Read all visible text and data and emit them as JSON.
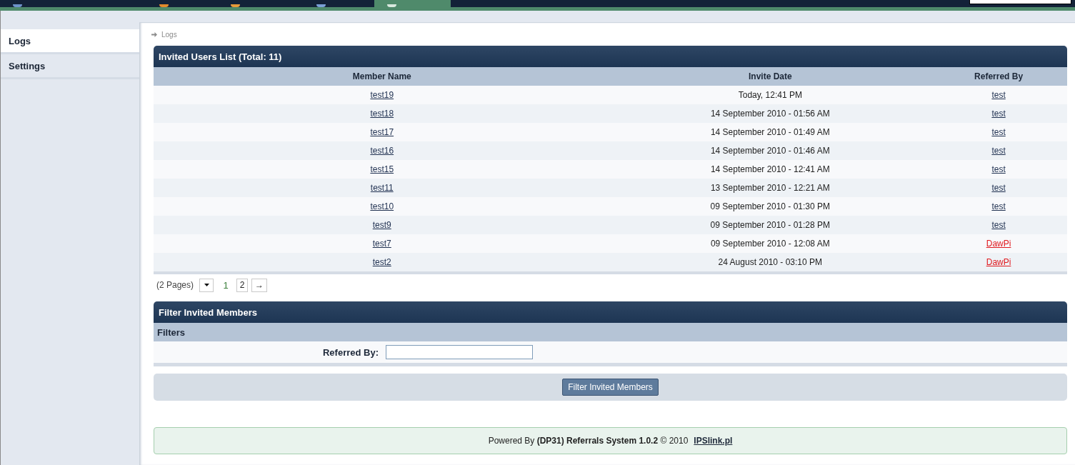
{
  "top_nav": {
    "tabs": [
      {
        "selected": false
      },
      {
        "selected": false
      },
      {
        "selected": false
      },
      {
        "selected": false
      },
      {
        "selected": true
      }
    ]
  },
  "sidebar": {
    "items": [
      {
        "label": "Logs",
        "selected": true
      },
      {
        "label": "Settings",
        "selected": false
      }
    ]
  },
  "breadcrumb": [
    "Logs"
  ],
  "invited_list": {
    "title": "Invited Users List (Total: 11)",
    "columns": [
      "Member Name",
      "Invite Date",
      "Referred By"
    ],
    "rows": [
      {
        "member": "test19",
        "invite_date": "Today, 12:41 PM",
        "referred_by": "test",
        "color": "#1f3050"
      },
      {
        "member": "test18",
        "invite_date": "14 September 2010 - 01:56 AM",
        "referred_by": "test",
        "color": "#1f3050"
      },
      {
        "member": "test17",
        "invite_date": "14 September 2010 - 01:49 AM",
        "referred_by": "test",
        "color": "#1f3050"
      },
      {
        "member": "test16",
        "invite_date": "14 September 2010 - 01:46 AM",
        "referred_by": "test",
        "color": "#1f3050"
      },
      {
        "member": "test15",
        "invite_date": "14 September 2010 - 12:41 AM",
        "referred_by": "test",
        "color": "#1f3050"
      },
      {
        "member": "test11",
        "invite_date": "13 September 2010 - 12:21 AM",
        "referred_by": "test",
        "color": "#1f3050"
      },
      {
        "member": "test10",
        "invite_date": "09 September 2010 - 01:30 PM",
        "referred_by": "test",
        "color": "#1f3050"
      },
      {
        "member": "test9",
        "invite_date": "09 September 2010 - 01:28 PM",
        "referred_by": "test",
        "color": "#1f3050"
      },
      {
        "member": "test7",
        "invite_date": "09 September 2010 - 12:08 AM",
        "referred_by": "DawPi",
        "color": "#e0191e"
      },
      {
        "member": "test2",
        "invite_date": "24 August 2010 - 03:10 PM",
        "referred_by": "DawPi",
        "color": "#e0191e"
      }
    ]
  },
  "pagination": {
    "summary": "(2 Pages)",
    "pages": [
      {
        "label": "1",
        "selected": true
      },
      {
        "label": "2",
        "selected": false
      }
    ],
    "next": "→"
  },
  "filter": {
    "title": "Filter Invited Members",
    "section": "Filters",
    "fields": [
      {
        "label": "Referred By:"
      }
    ],
    "button": "Filter Invited Members"
  },
  "footer": {
    "text": "Powered By **(DP31) Referrals System 1.0.2** © 2010",
    "link": "IPSlink.pl"
  }
}
